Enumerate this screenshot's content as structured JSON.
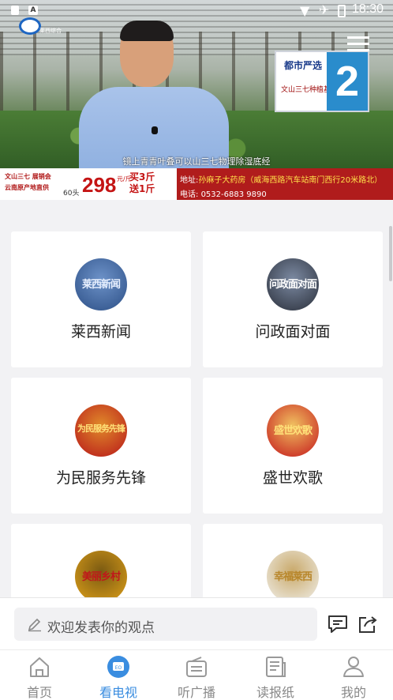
{
  "status_bar": {
    "time": "18:30"
  },
  "video": {
    "channel_logo_text": "莱西综合",
    "sign_title": "都市严选",
    "sign_subtitle": "文山三七种植基地",
    "sign_number": "2",
    "subtitle": "镜上青青叶叠可以山三七物理除湿底经",
    "ad": {
      "brand": "文山三七 展销会",
      "brand_sub": "云南原产地直供",
      "quantity": "60头",
      "price": "298",
      "price_unit": "元/斤",
      "deal_line1": "买3斤",
      "deal_line2": "送1斤",
      "address_label": "地址:",
      "address": "孙麻子大药房（威海西路汽车站南门西行20米路北）",
      "phone_label": "电话:",
      "phone": "0532-6883 9890"
    }
  },
  "programs": [
    {
      "label": "莱西新闻",
      "thumb_text": "莱西新闻",
      "colors": [
        "#2c4f86",
        "#6d92c8"
      ]
    },
    {
      "label": "问政面对面",
      "thumb_text": "问政面对面",
      "colors": [
        "#2a2f3a",
        "#7c8aa2"
      ]
    },
    {
      "label": "为民服务先锋",
      "thumb_text": "为民服务先锋",
      "colors": [
        "#b7161a",
        "#e08a2a"
      ]
    },
    {
      "label": "盛世欢歌",
      "thumb_text": "盛世欢歌",
      "colors": [
        "#c4161b",
        "#f0c060"
      ]
    },
    {
      "label": "",
      "thumb_text": "美丽乡村",
      "colors": [
        "#e0a11a",
        "#7a5a12"
      ]
    },
    {
      "label": "",
      "thumb_text": "幸福莱西",
      "colors": [
        "#f1f1ee",
        "#c9a96a"
      ]
    }
  ],
  "comment": {
    "placeholder": "欢迎发表你的观点"
  },
  "nav": {
    "items": [
      {
        "label": "首页",
        "icon": "home-icon"
      },
      {
        "label": "看电视",
        "icon": "tv-icon"
      },
      {
        "label": "听广播",
        "icon": "radio-icon"
      },
      {
        "label": "读报纸",
        "icon": "newspaper-icon"
      },
      {
        "label": "我的",
        "icon": "profile-icon"
      }
    ],
    "active_index": 1
  },
  "colors": {
    "accent": "#3a8de0",
    "ad_red": "#b01c1c"
  }
}
